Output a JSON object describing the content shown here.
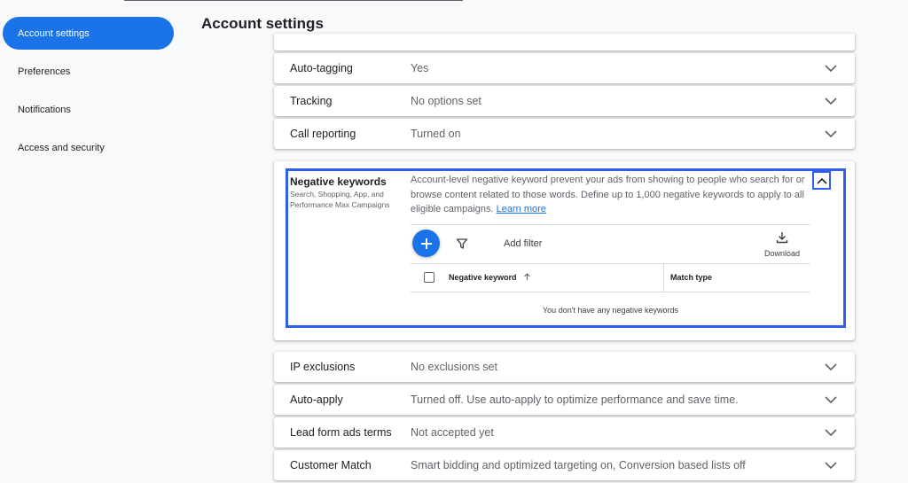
{
  "sidebar": {
    "items": [
      {
        "label": "Account settings",
        "active": true
      },
      {
        "label": "Preferences"
      },
      {
        "label": "Notifications"
      },
      {
        "label": "Access and security"
      }
    ]
  },
  "page": {
    "title": "Account settings"
  },
  "rows_top": [
    {
      "label": "Auto-tagging",
      "value": "Yes"
    },
    {
      "label": "Tracking",
      "value": "No options set"
    },
    {
      "label": "Call reporting",
      "value": "Turned on"
    }
  ],
  "negative_keywords": {
    "title": "Negative keywords",
    "subtitle": "Search, Shopping, App, and Performance Max Campaigns",
    "description": "Account-level negative keyword prevent your ads from showing to people who search for or browse content related to those words. Define up to 1,000 negative keywords to apply to all eligible campaigns.",
    "learn_more": "Learn more",
    "add_filter": "Add filter",
    "download": "Download",
    "columns": [
      "Negative keyword",
      "Match type"
    ],
    "empty_message": "You don't have any negative keywords"
  },
  "rows_bottom": [
    {
      "label": "IP exclusions",
      "value": "No exclusions set"
    },
    {
      "label": "Auto-apply",
      "value": "Turned off. Use auto-apply to optimize performance and save time."
    },
    {
      "label": "Lead form ads terms",
      "value": "Not accepted yet"
    },
    {
      "label": "Customer Match",
      "value": "Smart bidding and optimized targeting on, Conversion based lists off"
    }
  ],
  "colors": {
    "accent": "#1a73e8",
    "highlight": "#2f5ef0"
  }
}
